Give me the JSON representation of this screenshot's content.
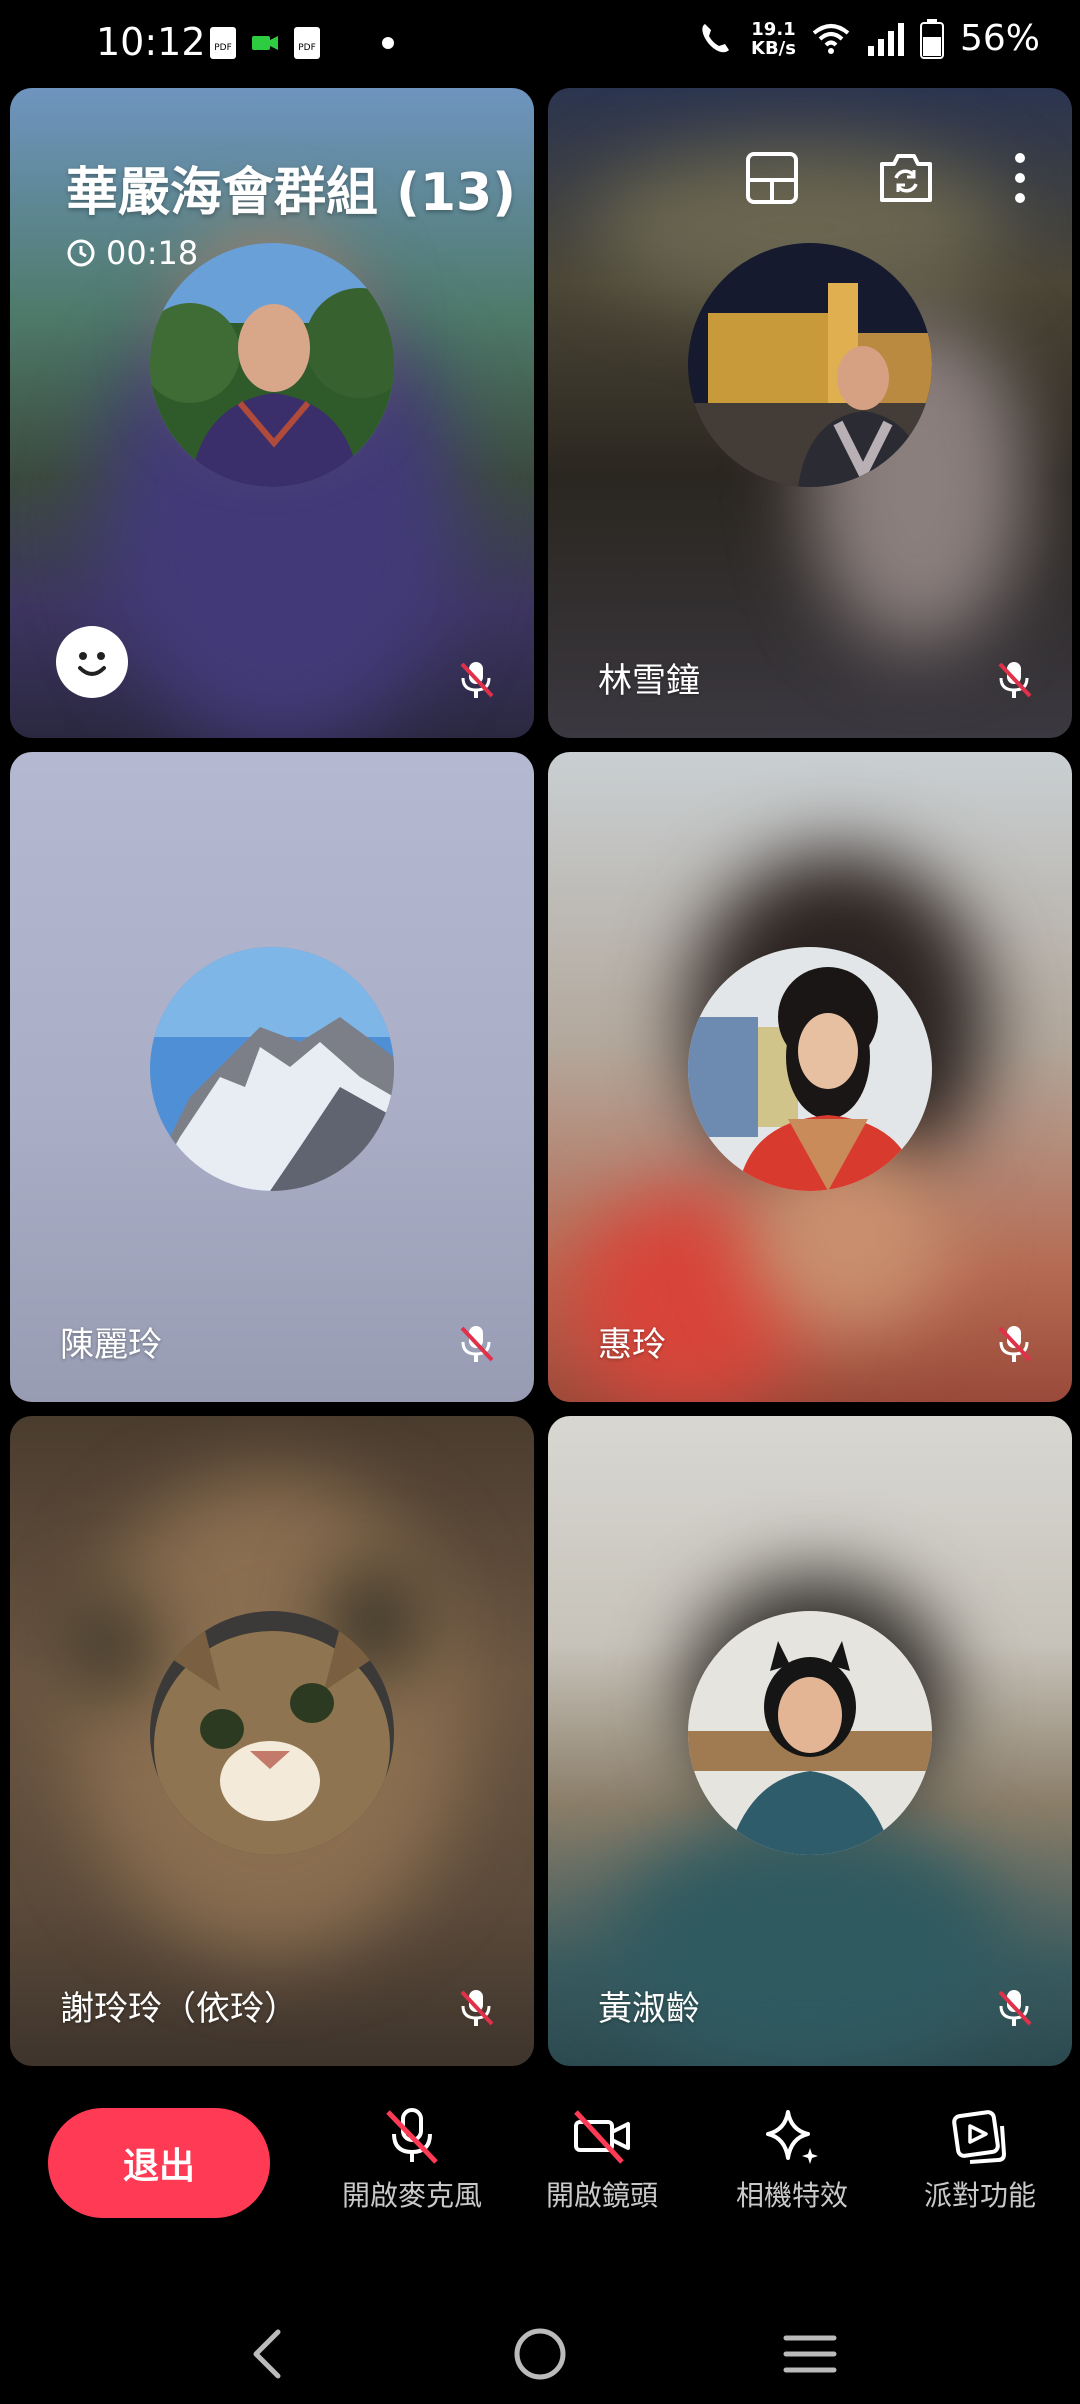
{
  "status_bar": {
    "time": "10:12",
    "net_speed_top": "19.1",
    "net_speed_bottom": "KB/s",
    "battery": "56%"
  },
  "call": {
    "group_title": "華嚴海會群組 (13)",
    "timer": "00:18"
  },
  "participants": [
    {
      "name": ""
    },
    {
      "name": "林雪鐘"
    },
    {
      "name": "陳麗玲"
    },
    {
      "name": "惠玲"
    },
    {
      "name": "謝玲玲（依玲）"
    },
    {
      "name": "黃淑齡"
    }
  ],
  "toolbar": {
    "exit_label": "退出",
    "mic_label": "開啟麥克風",
    "camera_label": "開啟鏡頭",
    "effects_label": "相機特效",
    "party_label": "派對功能"
  },
  "colors": {
    "exit_button": "#ff3a55",
    "background": "#000000"
  }
}
